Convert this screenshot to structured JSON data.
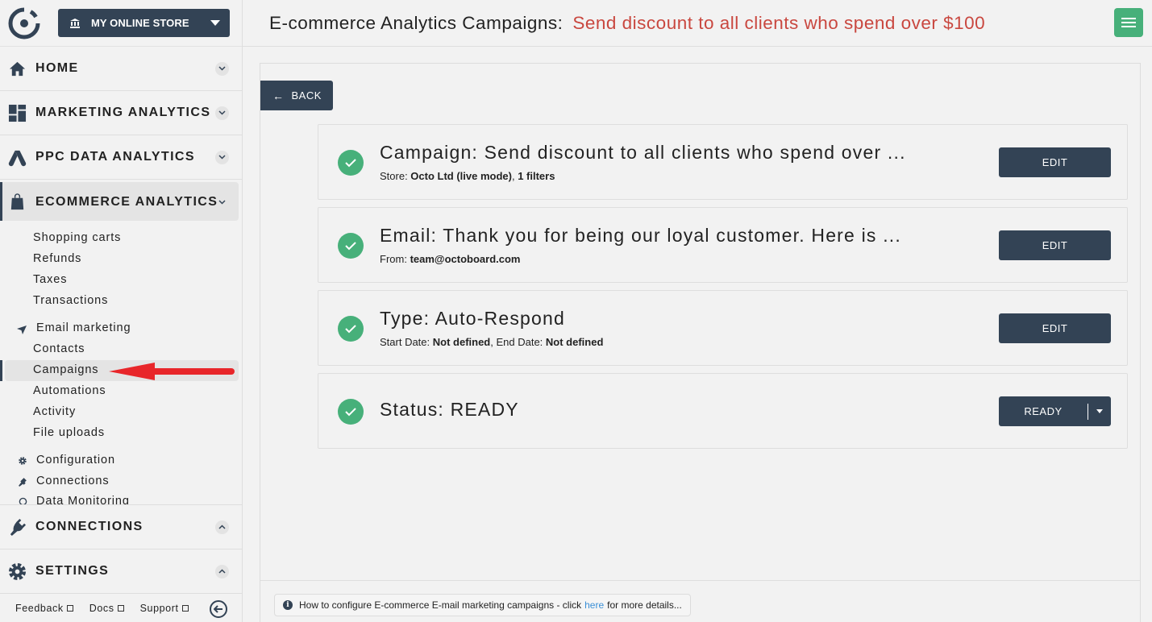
{
  "sidebar": {
    "store_selector": {
      "label": "MY ONLINE STORE",
      "icon": "bank-icon"
    },
    "sections": [
      {
        "label": "HOME",
        "icon": "home-icon",
        "chevron": "chevron-down"
      },
      {
        "label": "MARKETING ANALYTICS",
        "icon": "dashboard-icon",
        "chevron": "chevron-down"
      },
      {
        "label": "PPC DATA ANALYTICS",
        "icon": "google-ads-icon",
        "chevron": "chevron-down"
      },
      {
        "label": "ECOMMERCE ANALYTICS",
        "icon": "shopping-bag-icon",
        "chevron": "chevron-down",
        "active": true
      }
    ],
    "ecommerce_items": [
      "Shopping carts",
      "Refunds",
      "Taxes",
      "Transactions"
    ],
    "email_marketing": {
      "label": "Email marketing",
      "icon": "paper-plane-icon",
      "items": [
        "Contacts",
        "Campaigns",
        "Automations",
        "Activity",
        "File uploads"
      ],
      "active_item": "Campaigns"
    },
    "extra_items": [
      {
        "label": "Configuration",
        "icon": "gear-icon"
      },
      {
        "label": "Connections",
        "icon": "plug-icon"
      },
      {
        "label": "Data Monitoring",
        "icon": "circle-icon"
      }
    ],
    "bottom_sections": [
      {
        "label": "CONNECTIONS",
        "icon": "plug-icon",
        "chevron": "chevron-up"
      },
      {
        "label": "SETTINGS",
        "icon": "gear-icon",
        "chevron": "chevron-up"
      }
    ],
    "footer_links": [
      "Feedback",
      "Docs",
      "Support"
    ]
  },
  "header": {
    "title": "E-commerce Analytics Campaigns:",
    "subtitle": "Send discount to all clients who spend over $100",
    "accent_color": "#c9473f",
    "menu_button_color": "#47b07a"
  },
  "main": {
    "back_label": "BACK",
    "cards": [
      {
        "title": "Campaign: Send discount to all clients who spend over ...",
        "desc_prefix": "Store: ",
        "desc_bold": "Octo Ltd (live mode)",
        "desc_mid": ", ",
        "desc_bold2": "1 filters",
        "desc_mid2": "",
        "desc_bold3": "",
        "button": "EDIT",
        "status": "complete"
      },
      {
        "title": "Email: Thank you for being our loyal customer. Here is ...",
        "desc_prefix": "From: ",
        "desc_bold": "team@octoboard.com",
        "desc_mid": "",
        "desc_bold2": "",
        "desc_mid2": "",
        "desc_bold3": "",
        "button": "EDIT",
        "status": "complete"
      },
      {
        "title": "Type: Auto-Respond",
        "desc_prefix": "Start Date: ",
        "desc_bold": "Not defined",
        "desc_mid": ", End Date: ",
        "desc_bold2": "Not defined",
        "desc_mid2": "",
        "desc_bold3": "",
        "button": "EDIT",
        "status": "complete"
      },
      {
        "title": "Status: READY",
        "button": "READY",
        "status": "complete"
      }
    ],
    "info": {
      "before": "How to configure E-commerce E-mail marketing campaigns - click",
      "link": "here",
      "after": "for more details..."
    }
  }
}
